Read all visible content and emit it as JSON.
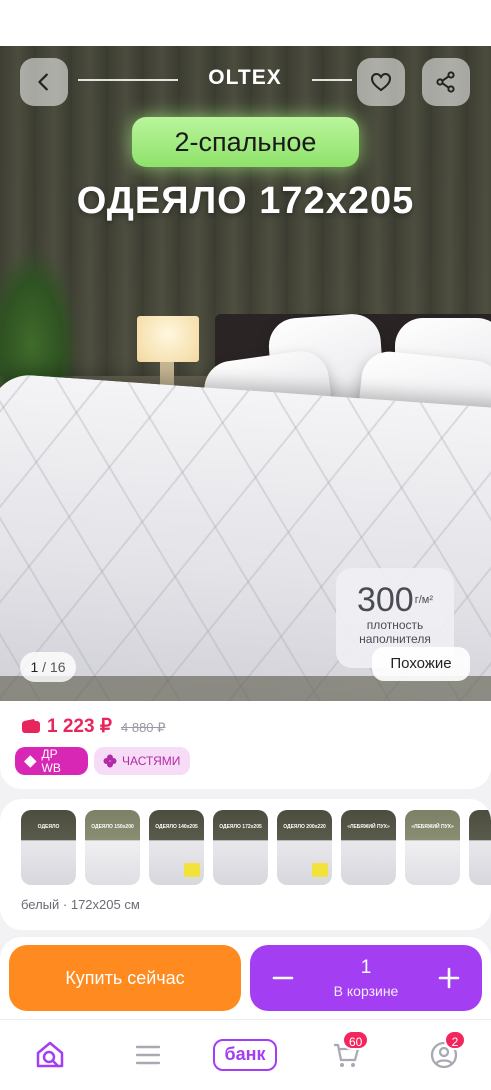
{
  "header": {
    "brand": "OLTEX"
  },
  "hero": {
    "badge": "2-спальное",
    "title": "ОДЕЯЛО 172x205",
    "density_value": "300",
    "density_unit": "г/м²",
    "density_caption_1": "плотность",
    "density_caption_2": "наполнителя",
    "counter_current": "1",
    "counter_total": "/ 16",
    "similar_label": "Похожие"
  },
  "price": {
    "current": "1 223 ₽",
    "old": "4 880 ₽",
    "tags": {
      "wb": "ДР WB",
      "parts": "ЧАСТЯМИ"
    }
  },
  "variants": {
    "thumbnails": [
      {
        "label": "ОДЕЯЛО"
      },
      {
        "label": "ОДЕЯЛО 150x200"
      },
      {
        "label": "ОДЕЯЛО 140x205"
      },
      {
        "label": "ОДЕЯЛО 172x205"
      },
      {
        "label": "ОДЕЯЛО 200x220"
      },
      {
        "label": "«ЛЕБЯЖИЙ ПУХ»"
      },
      {
        "label": "«ЛЕБЯЖИЙ ПУХ»"
      },
      {
        "label": ""
      }
    ],
    "selected_label": "белый · 172x205 см"
  },
  "actions": {
    "buy_now": "Купить сейчас",
    "cart_qty": "1",
    "cart_label": "В корзине"
  },
  "nav": {
    "bank": "банк",
    "cart_badge": "60",
    "profile_badge": "2"
  },
  "colors": {
    "accent_purple": "#a33ef2",
    "buy_orange": "#ff8a1f",
    "price_red": "#e8265e",
    "badge_green": "#9be97a"
  }
}
